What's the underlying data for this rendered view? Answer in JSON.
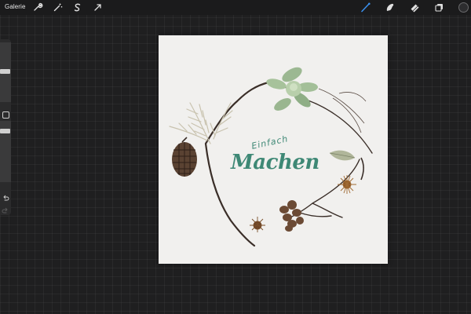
{
  "app": {
    "gallery_label": "Galerie"
  },
  "toolbar_left": [
    {
      "name": "wrench-icon"
    },
    {
      "name": "magic-wand-icon"
    },
    {
      "name": "selection-s-icon"
    },
    {
      "name": "transform-arrow-icon"
    }
  ],
  "toolbar_right": [
    {
      "name": "brush-icon",
      "active": true
    },
    {
      "name": "smudge-icon"
    },
    {
      "name": "eraser-icon"
    },
    {
      "name": "layers-icon"
    },
    {
      "name": "color-circle-icon"
    }
  ],
  "sidebar": {
    "brush_size_level": 0.18,
    "opacity_level": 0.5
  },
  "canvas": {
    "lettering_top": "Einfach",
    "lettering_main": "Machen"
  },
  "colors": {
    "accent_blue": "#3a8eea",
    "lettering_green": "#3e8875",
    "canvas_bg": "#f1f0ee",
    "app_bg": "#1f1f20"
  }
}
